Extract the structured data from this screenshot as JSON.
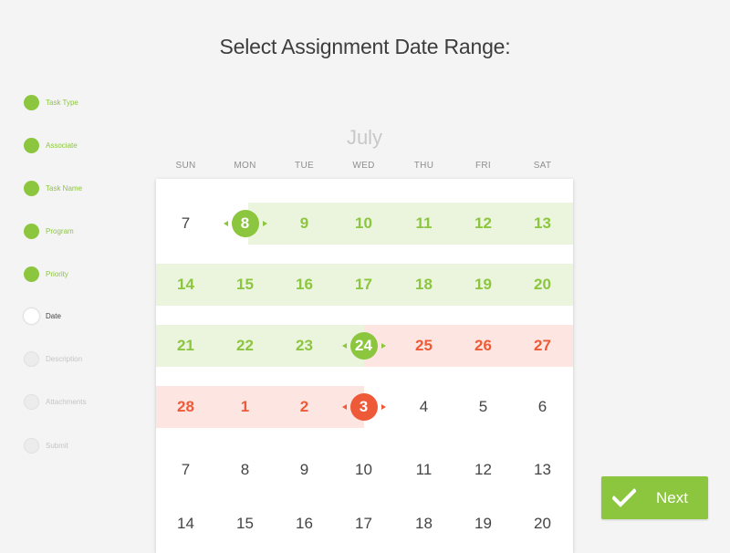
{
  "header": {
    "title": "Select Assignment Date Range:"
  },
  "steps": [
    {
      "label": "Task Type",
      "state": "done"
    },
    {
      "label": "Associate",
      "state": "done"
    },
    {
      "label": "Task Name",
      "state": "done"
    },
    {
      "label": "Program",
      "state": "done"
    },
    {
      "label": "Priority",
      "state": "done"
    },
    {
      "label": "Date",
      "state": "current"
    },
    {
      "label": "Description",
      "state": "todo"
    },
    {
      "label": "Attachments",
      "state": "todo"
    },
    {
      "label": "Submit",
      "state": "todo"
    }
  ],
  "calendar": {
    "month": "July",
    "weekdays": [
      "SUN",
      "MON",
      "TUE",
      "WED",
      "THU",
      "FRI",
      "SAT"
    ],
    "weeks": [
      [
        "7",
        "8",
        "9",
        "10",
        "11",
        "12",
        "13"
      ],
      [
        "14",
        "15",
        "16",
        "17",
        "18",
        "19",
        "20"
      ],
      [
        "21",
        "22",
        "23",
        "24",
        "25",
        "26",
        "27"
      ],
      [
        "28",
        "1",
        "2",
        "3",
        "4",
        "5",
        "6"
      ],
      [
        "7",
        "8",
        "9",
        "10",
        "11",
        "12",
        "13"
      ],
      [
        "14",
        "15",
        "16",
        "17",
        "18",
        "19",
        "20"
      ]
    ],
    "cell_states": [
      [
        "",
        "gm",
        "g",
        "g",
        "g",
        "g",
        "g"
      ],
      [
        "g",
        "g",
        "g",
        "g",
        "g",
        "g",
        "g"
      ],
      [
        "g",
        "g",
        "g",
        "gm",
        "r",
        "r",
        "r"
      ],
      [
        "r",
        "r",
        "r",
        "rm",
        "",
        "",
        ""
      ],
      [
        "",
        "",
        "",
        "",
        "",
        "",
        ""
      ],
      [
        "",
        "",
        "",
        "",
        "",
        "",
        ""
      ]
    ],
    "colors": {
      "range_primary": "#8cc63f",
      "range_secondary": "#ee5a38",
      "primary_bg": "#ebf4dd",
      "secondary_bg": "#fde6e1"
    }
  },
  "actions": {
    "next_label": "Next",
    "next_icon": "check-icon"
  }
}
